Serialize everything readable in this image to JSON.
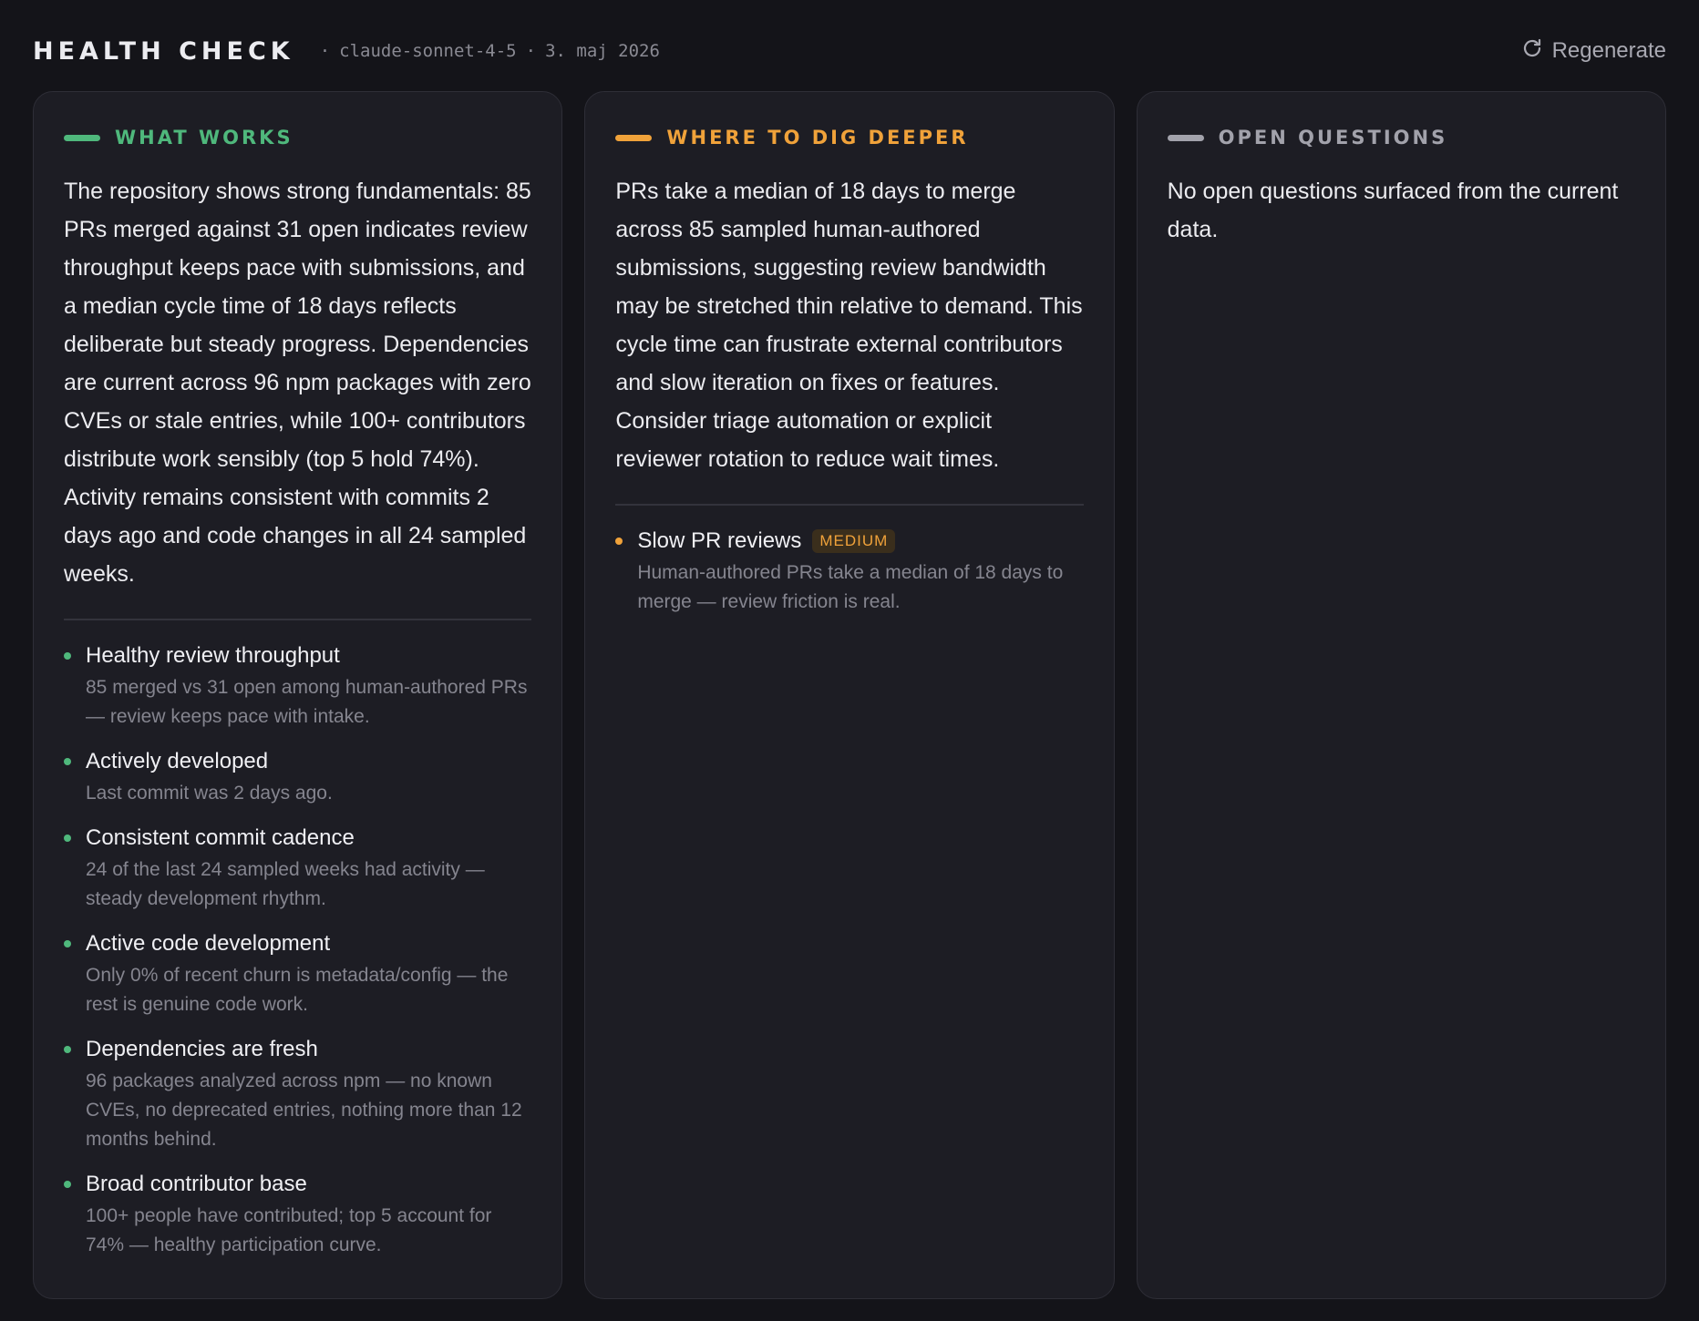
{
  "header": {
    "title": "HEALTH CHECK",
    "separator": "·",
    "model": "claude-sonnet-4-5",
    "date": "3. maj 2026",
    "regenerate_label": "Regenerate",
    "regenerate_icon": "refresh-icon"
  },
  "colors": {
    "works": "#4fb87c",
    "dig": "#f0a23a",
    "questions": "#a2a2ab"
  },
  "what_works": {
    "title": "WHAT WORKS",
    "summary": "The repository shows strong fundamentals: 85 PRs merged against 31 open indicates review throughput keeps pace with submissions, and a median cycle time of 18 days reflects deliberate but steady progress. Dependencies are current across 96 npm packages with zero CVEs or stale entries, while 100+ contributors distribute work sensibly (top 5 hold 74%). Activity remains consistent with commits 2 days ago and code changes in all 24 sampled weeks.",
    "items": [
      {
        "title": "Healthy review throughput",
        "desc": "85 merged vs 31 open among human-authored PRs — review keeps pace with intake."
      },
      {
        "title": "Actively developed",
        "desc": "Last commit was 2 days ago."
      },
      {
        "title": "Consistent commit cadence",
        "desc": "24 of the last 24 sampled weeks had activity — steady development rhythm."
      },
      {
        "title": "Active code development",
        "desc": "Only 0% of recent churn is metadata/config — the rest is genuine code work."
      },
      {
        "title": "Dependencies are fresh",
        "desc": "96 packages analyzed across npm — no known CVEs, no deprecated entries, nothing more than 12 months behind."
      },
      {
        "title": "Broad contributor base",
        "desc": "100+ people have contributed; top 5 account for 74% — healthy participation curve."
      }
    ]
  },
  "dig_deeper": {
    "title": "WHERE TO DIG DEEPER",
    "summary": "PRs take a median of 18 days to merge across 85 sampled human-authored submissions, suggesting review bandwidth may be stretched thin relative to demand. This cycle time can frustrate external contributors and slow iteration on fixes or features. Consider triage automation or explicit reviewer rotation to reduce wait times.",
    "items": [
      {
        "title": "Slow PR reviews",
        "badge": "MEDIUM",
        "desc": "Human-authored PRs take a median of 18 days to merge — review friction is real."
      }
    ]
  },
  "open_questions": {
    "title": "OPEN QUESTIONS",
    "summary": "No open questions surfaced from the current data."
  }
}
